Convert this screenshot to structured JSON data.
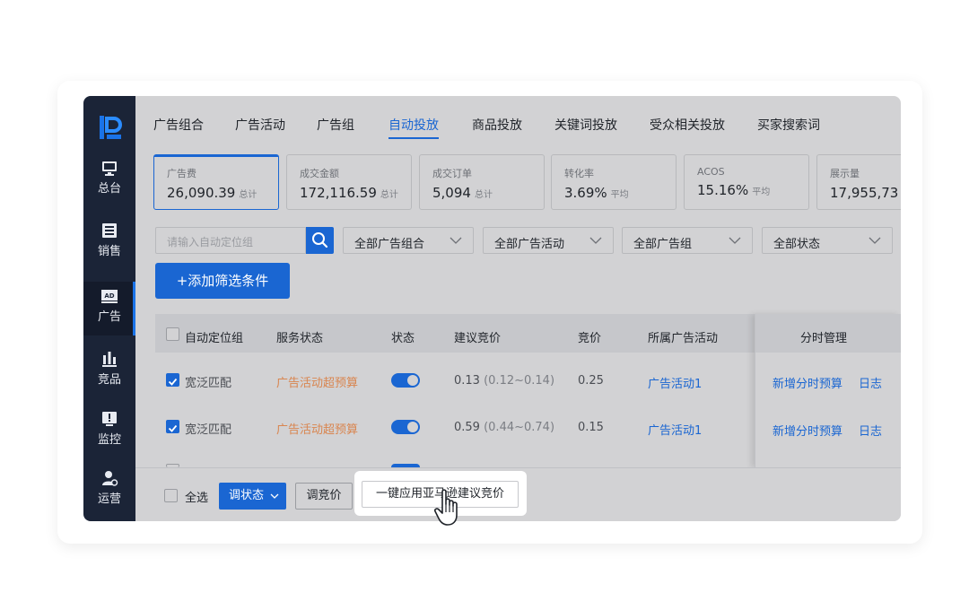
{
  "sidebar": {
    "items": [
      {
        "label": "总台",
        "icon": "monitor-icon"
      },
      {
        "label": "销售",
        "icon": "list-icon"
      },
      {
        "label": "广告",
        "icon": "ad-icon"
      },
      {
        "label": "竞品",
        "icon": "bar-chart-icon"
      },
      {
        "label": "监控",
        "icon": "alert-icon"
      },
      {
        "label": "运营",
        "icon": "user-gear-icon"
      }
    ]
  },
  "tabs": [
    "广告组合",
    "广告活动",
    "广告组",
    "自动投放",
    "商品投放",
    "关键词投放",
    "受众相关投放",
    "买家搜索词"
  ],
  "active_tab": "自动投放",
  "metrics": [
    {
      "label": "广告费",
      "value": "26,090.39",
      "suffix": "总计"
    },
    {
      "label": "成交金额",
      "value": "172,116.59",
      "suffix": "总计"
    },
    {
      "label": "成交订单",
      "value": "5,094",
      "suffix": "总计"
    },
    {
      "label": "转化率",
      "value": "3.69%",
      "suffix": "平均"
    },
    {
      "label": "ACOS",
      "value": "15.16%",
      "suffix": "平均"
    },
    {
      "label": "展示量",
      "value": "17,955,73",
      "suffix": ""
    }
  ],
  "filters": {
    "search_placeholder": "请输入自动定位组",
    "selects": [
      "全部广告组合",
      "全部广告活动",
      "全部广告组",
      "全部状态"
    ],
    "add_button": "+添加筛选条件"
  },
  "table": {
    "headers": [
      "自动定位组",
      "服务状态",
      "状态",
      "建议竞价",
      "竞价",
      "所属广告活动",
      "分时管理"
    ],
    "rows": [
      {
        "name": "宽泛匹配",
        "service_status": "广告活动超预算",
        "status_on": true,
        "suggested": "0.13",
        "range": "(0.12~0.14)",
        "bid": "0.25",
        "campaign": "广告活动1",
        "action1": "新增分时预算",
        "action2": "日志"
      },
      {
        "name": "宽泛匹配",
        "service_status": "广告活动超预算",
        "status_on": true,
        "suggested": "0.59",
        "range": "(0.44~0.74)",
        "bid": "0.15",
        "campaign": "广告活动1",
        "action1": "新增分时预算",
        "action2": "日志"
      }
    ]
  },
  "footer": {
    "select_all": "全选",
    "adjust_status": "调状态",
    "adjust_bid": "调竞价",
    "apply_amazon": "一键应用亚马逊建议竞价"
  },
  "colors": {
    "primary": "#1a66d2",
    "sidebar": "#1b2437",
    "warning": "#d9854f"
  }
}
